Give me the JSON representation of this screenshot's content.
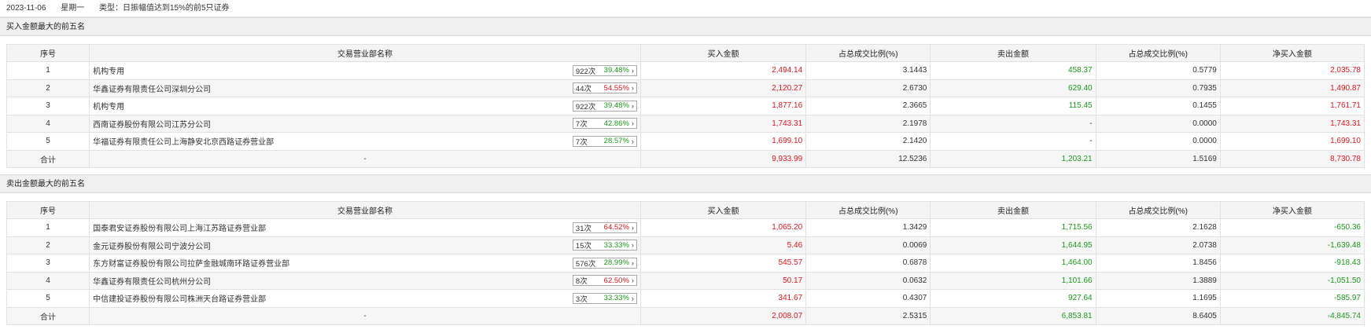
{
  "header": {
    "date": "2023-11-06",
    "weekday": "星期一",
    "type_label": "类型：日振幅值达到15%的前5只证券"
  },
  "columns": [
    "序号",
    "交易营业部名称",
    "买入金额",
    "占总成交比例(%)",
    "卖出金额",
    "占总成交比例(%)",
    "净买入金额"
  ],
  "buy_section": {
    "title": "买入金额最大的前五名",
    "rows": [
      {
        "idx": "1",
        "name": "机构专用",
        "count": "922次",
        "pct": "39.48%",
        "pct_color": "green",
        "buy": "2,494.14",
        "buy_ratio": "3.1443",
        "sell": "458.37",
        "sell_ratio": "0.5779",
        "net": "2,035.78",
        "net_color": "red"
      },
      {
        "idx": "2",
        "name": "华鑫证券有限责任公司深圳分公司",
        "count": "44次",
        "pct": "54.55%",
        "pct_color": "red",
        "buy": "2,120.27",
        "buy_ratio": "2.6730",
        "sell": "629.40",
        "sell_ratio": "0.7935",
        "net": "1,490.87",
        "net_color": "red"
      },
      {
        "idx": "3",
        "name": "机构专用",
        "count": "922次",
        "pct": "39.48%",
        "pct_color": "green",
        "buy": "1,877.16",
        "buy_ratio": "2.3665",
        "sell": "115.45",
        "sell_ratio": "0.1455",
        "net": "1,761.71",
        "net_color": "red"
      },
      {
        "idx": "4",
        "name": "西南证券股份有限公司江苏分公司",
        "count": "7次",
        "pct": "42.86%",
        "pct_color": "green",
        "buy": "1,743.31",
        "buy_ratio": "2.1978",
        "sell": "-",
        "sell_ratio": "0.0000",
        "net": "1,743.31",
        "net_color": "red"
      },
      {
        "idx": "5",
        "name": "华福证券有限责任公司上海静安北京西路证券营业部",
        "count": "7次",
        "pct": "28.57%",
        "pct_color": "green",
        "buy": "1,699.10",
        "buy_ratio": "2.1420",
        "sell": "-",
        "sell_ratio": "0.0000",
        "net": "1,699.10",
        "net_color": "red"
      }
    ],
    "total": {
      "label": "合计",
      "name": "-",
      "buy": "9,933.99",
      "buy_ratio": "12.5236",
      "sell": "1,203.21",
      "sell_ratio": "1.5169",
      "net": "8,730.78",
      "net_color": "red"
    }
  },
  "sell_section": {
    "title": "卖出金额最大的前五名",
    "rows": [
      {
        "idx": "1",
        "name": "国泰君安证券股份有限公司上海江苏路证券营业部",
        "count": "31次",
        "pct": "64.52%",
        "pct_color": "red",
        "buy": "1,065.20",
        "buy_ratio": "1.3429",
        "sell": "1,715.56",
        "sell_ratio": "2.1628",
        "net": "-650.36",
        "net_color": "green"
      },
      {
        "idx": "2",
        "name": "金元证券股份有限公司宁波分公司",
        "count": "15次",
        "pct": "33.33%",
        "pct_color": "green",
        "buy": "5.46",
        "buy_ratio": "0.0069",
        "sell": "1,644.95",
        "sell_ratio": "2.0738",
        "net": "-1,639.48",
        "net_color": "green"
      },
      {
        "idx": "3",
        "name": "东方财富证券股份有限公司拉萨金融城南环路证券营业部",
        "count": "576次",
        "pct": "28.99%",
        "pct_color": "green",
        "buy": "545.57",
        "buy_ratio": "0.6878",
        "sell": "1,464.00",
        "sell_ratio": "1.8456",
        "net": "-918.43",
        "net_color": "green"
      },
      {
        "idx": "4",
        "name": "华鑫证券有限责任公司杭州分公司",
        "count": "8次",
        "pct": "62.50%",
        "pct_color": "red",
        "buy": "50.17",
        "buy_ratio": "0.0632",
        "sell": "1,101.66",
        "sell_ratio": "1.3889",
        "net": "-1,051.50",
        "net_color": "green"
      },
      {
        "idx": "5",
        "name": "中信建投证券股份有限公司株洲天台路证券营业部",
        "count": "3次",
        "pct": "33.33%",
        "pct_color": "green",
        "buy": "341.67",
        "buy_ratio": "0.4307",
        "sell": "927.64",
        "sell_ratio": "1.1695",
        "net": "-585.97",
        "net_color": "green"
      }
    ],
    "total": {
      "label": "合计",
      "name": "-",
      "buy": "2,008.07",
      "buy_ratio": "2.5315",
      "sell": "6,853.81",
      "sell_ratio": "8.6405",
      "net": "-4,845.74",
      "net_color": "green"
    }
  },
  "colors": {
    "red": "#e0181c",
    "green": "#1a9a1a"
  },
  "icons": {
    "badge_arrow": "chevron-right-icon"
  }
}
